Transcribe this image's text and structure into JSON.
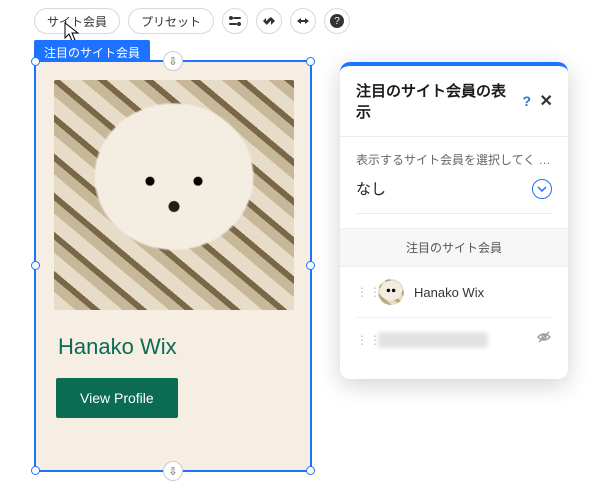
{
  "toolbar": {
    "btn1": "サイト会員",
    "btn2": "プリセット"
  },
  "selection": {
    "tag": "注目のサイト会員"
  },
  "card": {
    "member_name": "Hanako Wix",
    "view_profile": "View Profile"
  },
  "panel": {
    "title": "注目のサイト会員の表示",
    "help": "?",
    "close": "✕",
    "instruction": "表示するサイト会員を選択してく …",
    "select_value": "なし",
    "section_label": "注目のサイト会員",
    "members": [
      {
        "name": "Hanako Wix",
        "hidden": false
      },
      {
        "name": "",
        "hidden": true
      }
    ]
  }
}
